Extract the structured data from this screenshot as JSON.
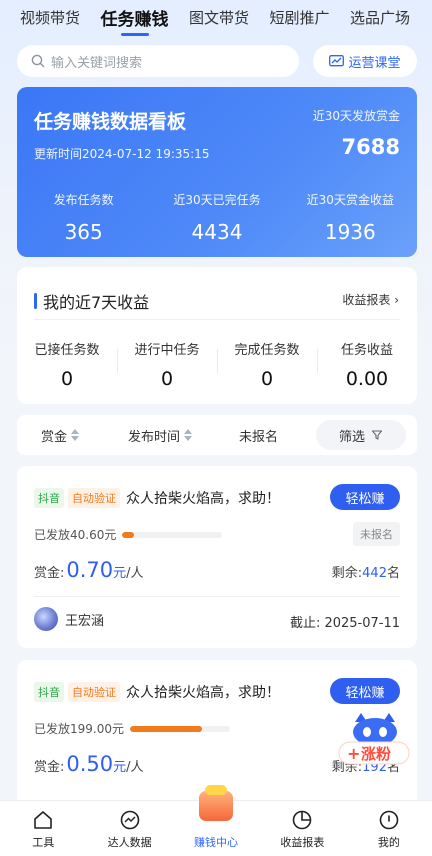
{
  "tabs": [
    "视频带货",
    "任务赚钱",
    "图文带货",
    "短剧推广",
    "选品广场"
  ],
  "active_tab": 1,
  "search": {
    "placeholder": "输入关键词搜索"
  },
  "course_button": "运营课堂",
  "board": {
    "title": "任务赚钱数据看板",
    "updated": "更新时间2024-07-12 19:35:15",
    "reward_label": "近30天发放赏金",
    "reward_value": "7688",
    "stats": [
      {
        "label": "发布任务数",
        "value": "365"
      },
      {
        "label": "近30天已完任务",
        "value": "4434"
      },
      {
        "label": "近30天赏金收益",
        "value": "1936"
      }
    ]
  },
  "income": {
    "title": "我的近7天收益",
    "report_link": "收益报表",
    "cells": [
      {
        "label": "已接任务数",
        "value": "0"
      },
      {
        "label": "进行中任务",
        "value": "0"
      },
      {
        "label": "完成任务数",
        "value": "0"
      },
      {
        "label": "任务收益",
        "value": "0.00"
      }
    ]
  },
  "filters": {
    "reward": "赏金",
    "time": "发布时间",
    "unregistered": "未报名",
    "filter": "筛选"
  },
  "tasks": [
    {
      "tag_platform": "抖音",
      "tag_verify": "自动验证",
      "title": "众人拾柴火焰高，求助！",
      "button": "轻松赚",
      "paid": "已发放40.60元",
      "progress": 0.12,
      "status": "未报名",
      "reward_prefix": "赏金:",
      "reward_amount": "0.70",
      "reward_unit": "元",
      "reward_per": "/人",
      "remain_label": "剩余:",
      "remain_count": "442",
      "remain_unit": "名",
      "user": "王宏涵",
      "deadline": "截止:  2025-07-11"
    },
    {
      "tag_platform": "抖音",
      "tag_verify": "自动验证",
      "title": "众人拾柴火焰高，求助！",
      "button": "轻松赚",
      "paid": "已发放199.00元",
      "progress": 0.72,
      "reward_prefix": "赏金:",
      "reward_amount": "0.50",
      "reward_unit": "元",
      "reward_per": "/人",
      "remain_label": "剩余:",
      "remain_count": "192",
      "remain_unit": "名"
    }
  ],
  "mascot_label": "涨粉",
  "nav": [
    {
      "label": "工具",
      "icon": "home-icon"
    },
    {
      "label": "达人数据",
      "icon": "chart-line-icon"
    },
    {
      "label": "赚钱中心",
      "icon": "wallet-icon"
    },
    {
      "label": "收益报表",
      "icon": "pie-chart-icon"
    },
    {
      "label": "我的",
      "icon": "user-icon"
    }
  ],
  "colors": {
    "accent": "#2f66f6",
    "progress": "#f27a1a",
    "tag_douyin": "#2ea44f",
    "tag_verify": "#f07a1f"
  }
}
